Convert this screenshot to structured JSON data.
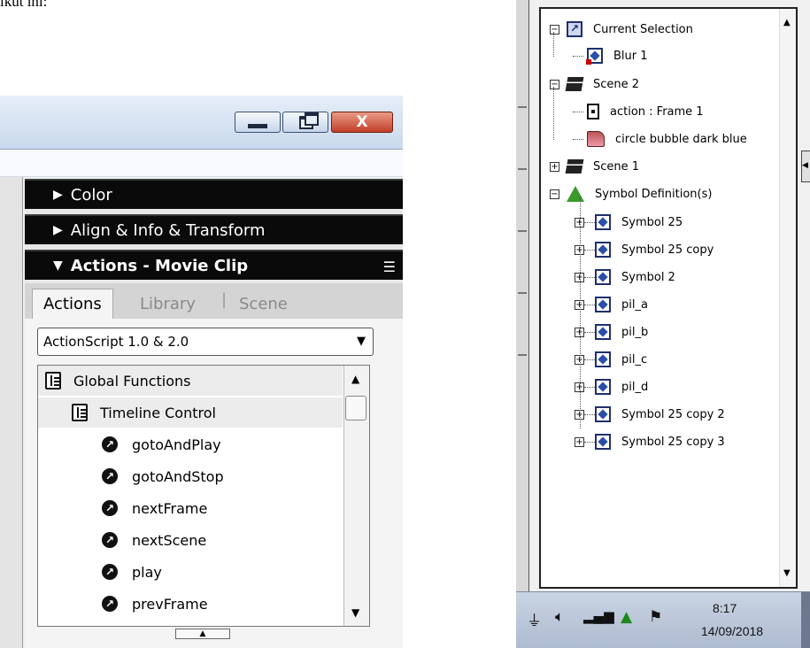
{
  "doc_fragment": "ikut ini:",
  "left_window": {
    "buttons": {
      "minimize": "minimize",
      "maximize": "restore",
      "close": "X"
    },
    "panels": {
      "color": "Color",
      "align": "Align & Info & Transform",
      "actions": "Actions - Movie Clip"
    },
    "tabs": {
      "actions": "Actions",
      "library": "Library",
      "separator": "|",
      "scene": "Scene"
    },
    "version_select": "ActionScript 1.0 & 2.0",
    "tree": [
      {
        "label": "Global Functions",
        "kind": "book",
        "level": 0
      },
      {
        "label": "Timeline Control",
        "kind": "book",
        "level": 1
      },
      {
        "label": "gotoAndPlay",
        "kind": "function",
        "level": 2
      },
      {
        "label": "gotoAndStop",
        "kind": "function",
        "level": 2
      },
      {
        "label": "nextFrame",
        "kind": "function",
        "level": 2
      },
      {
        "label": "nextScene",
        "kind": "function",
        "level": 2
      },
      {
        "label": "play",
        "kind": "function",
        "level": 2
      },
      {
        "label": "prevFrame",
        "kind": "function",
        "level": 2
      }
    ]
  },
  "scene_tree": {
    "current_selection": "Current Selection",
    "blur": "Blur 1",
    "scene2": "Scene 2",
    "action_frame": "action : Frame 1",
    "circle_bubble": "circle bubble dark blue",
    "scene1": "Scene 1",
    "symbol_defs": "Symbol Definition(s)",
    "symbols": [
      "Symbol 25",
      "Symbol 25 copy",
      "Symbol 2",
      "pil_a",
      "pil_b",
      "pil_c",
      "pil_d",
      "Symbol 25 copy 2",
      "Symbol 25 copy 3"
    ]
  },
  "taskbar": {
    "time": "8:17",
    "date": "14/09/2018",
    "icons": [
      "network-plug-icon",
      "speaker-icon",
      "signal-bars-icon",
      "warning-triangle-icon",
      "flag-error-icon"
    ]
  }
}
